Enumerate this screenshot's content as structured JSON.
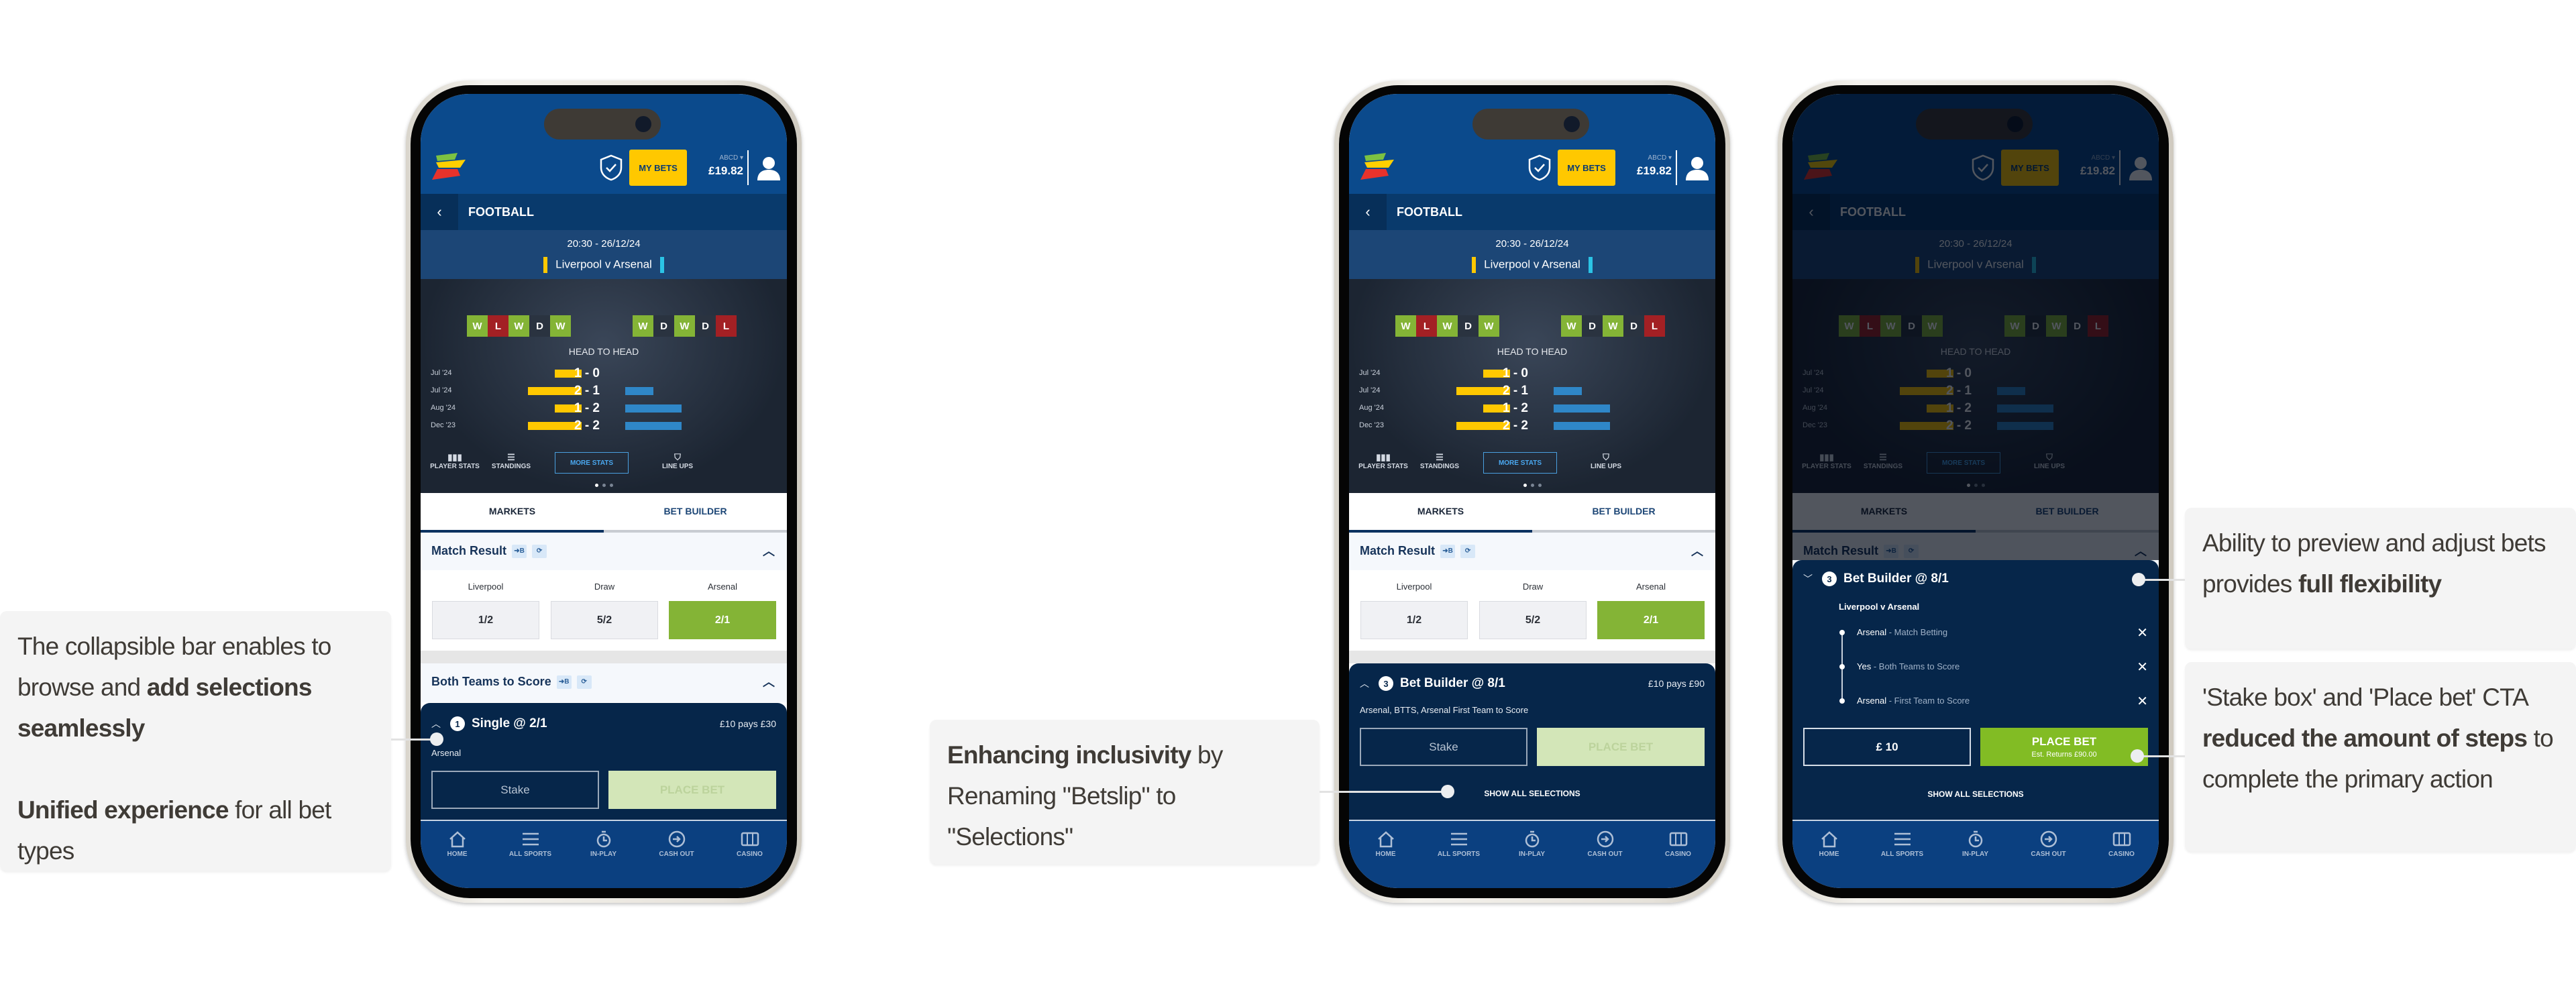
{
  "app": {
    "header": {
      "my_bets": "MY BETS",
      "account": "ABCD ▾",
      "balance": "£19.82"
    },
    "nav_title": "FOOTBALL",
    "match": {
      "time": "20:30 - 26/12/24",
      "teams": "Liverpool v Arsenal",
      "home_color": "#ffc800",
      "away_color": "#2bc4e6"
    },
    "form": {
      "home": [
        "W",
        "L",
        "W",
        "D",
        "W"
      ],
      "away": [
        "W",
        "D",
        "W",
        "D",
        "L"
      ]
    },
    "h2h": {
      "title": "HEAD TO HEAD",
      "rows": [
        {
          "date": "Jul '24",
          "score": "1 - 0"
        },
        {
          "date": "Jul '24",
          "score": "2 - 1"
        },
        {
          "date": "Aug '24",
          "score": "1 - 2"
        },
        {
          "date": "Dec '23",
          "score": "2 - 2"
        }
      ]
    },
    "stat_tabs": [
      "PLAYER STATS",
      "STANDINGS",
      "MORE STATS",
      "LINE UPS"
    ],
    "stat_tabs_active": 2,
    "tabs": [
      "MARKETS",
      "BET BUILDER"
    ],
    "market": {
      "title": "Match Result",
      "outcomes": [
        {
          "label": "Liverpool",
          "odds": "1/2"
        },
        {
          "label": "Draw",
          "odds": "5/2"
        },
        {
          "label": "Arsenal",
          "odds": "2/1"
        }
      ],
      "selected": 2
    },
    "market2_title": "Both Teams to Score",
    "bottom_nav": [
      "HOME",
      "ALL SPORTS",
      "IN-PLAY",
      "CASH OUT",
      "CASINO"
    ],
    "colors": {
      "win": "#84b436",
      "loss": "#a32024",
      "draw": "#2a3340",
      "accent": "#ffc800",
      "header": "#0b4a8c",
      "betslip": "#06264a"
    }
  },
  "screens": [
    {
      "betslip": {
        "count": "1",
        "title": "Single  @ 2/1",
        "returns": "£10 pays £30",
        "desc": "Arsenal",
        "stake": "Stake",
        "place_bet": "PLACE BET"
      }
    },
    {
      "betslip": {
        "count": "3",
        "title": "Bet Builder  @ 8/1",
        "returns": "£10 pays £90",
        "desc": "Arsenal, BTTS, Arsenal First Team to Score",
        "stake": "Stake",
        "place_bet": "PLACE BET",
        "show_all": "SHOW ALL SELECTIONS"
      }
    },
    {
      "betslip": {
        "count": "3",
        "title": "Bet Builder @ 8/1",
        "event": "Liverpool v Arsenal",
        "legs": [
          {
            "selection": "Arsenal",
            "market": "Match Betting"
          },
          {
            "selection": "Yes",
            "market": "Both Teams to Score"
          },
          {
            "selection": "Arsenal",
            "market": "First Team to Score"
          }
        ],
        "stake": "£ 10",
        "place_bet": "PLACE BET",
        "est_returns": "Est. Returns £90.00",
        "show_all": "SHOW ALL SELECTIONS"
      }
    }
  ],
  "notes": [
    {
      "p1": "The collapsible bar enables to browse and ",
      "b1": "add selections seamlessly",
      "b2": "Unified experience",
      "p2": " for all bet types"
    },
    {
      "b1": "Enhancing inclusivity",
      "p1": " by Renaming \"Betslip\" to \"Selections\""
    },
    {
      "p1": "Ability to preview and adjust bets provides ",
      "b1": "full flexibility"
    },
    {
      "p1": "'Stake box' and 'Place bet' CTA ",
      "b1": "reduced the amount of steps",
      "p2": " to complete the primary action"
    }
  ]
}
